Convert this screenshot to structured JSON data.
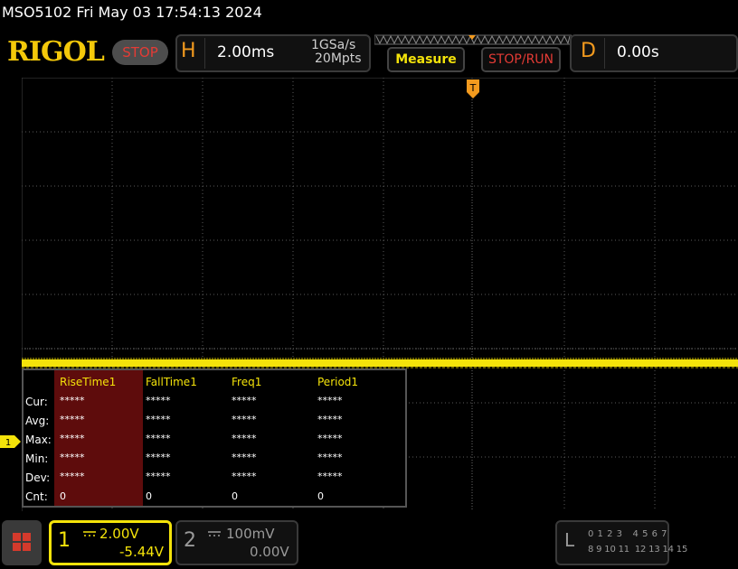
{
  "header": {
    "title": "MSO5102  Fri May 03 17:54:13 2024"
  },
  "topbar": {
    "logo": "RIGOL",
    "run_state": "STOP",
    "horizontal": {
      "letter": "H",
      "timebase": "2.00ms",
      "sample_rate": "1GSa/s",
      "memory_depth": "20Mpts"
    },
    "measure_label": "Measure",
    "stop_run_label": "STOP/RUN",
    "delay": {
      "letter": "D",
      "value": "0.00s"
    }
  },
  "measurements": {
    "headers": [
      "RiseTime1",
      "FallTime1",
      "Freq1",
      "Period1"
    ],
    "rows": [
      {
        "label": "Cur:",
        "values": [
          "*****",
          "*****",
          "*****",
          "*****"
        ]
      },
      {
        "label": "Avg:",
        "values": [
          "*****",
          "*****",
          "*****",
          "*****"
        ]
      },
      {
        "label": "Max:",
        "values": [
          "*****",
          "*****",
          "*****",
          "*****"
        ]
      },
      {
        "label": "Min:",
        "values": [
          "*****",
          "*****",
          "*****",
          "*****"
        ]
      },
      {
        "label": "Dev:",
        "values": [
          "*****",
          "*****",
          "*****",
          "*****"
        ]
      },
      {
        "label": "Cnt:",
        "values": [
          "0",
          "0",
          "0",
          "0"
        ]
      }
    ]
  },
  "markers": {
    "trigger": "T",
    "ch1": "1"
  },
  "channels": {
    "ch1": {
      "number": "1",
      "scale": "2.00V",
      "offset": "-5.44V",
      "color": "#f4e30a"
    },
    "ch2": {
      "number": "2",
      "scale": "100mV",
      "offset": "0.00V",
      "color": "#9a9a9a"
    }
  },
  "logic": {
    "letter": "L",
    "row1": "0 1 2 3   4 5 6 7",
    "row2": "8 9 10 11  12 13 14 15"
  },
  "colors": {
    "accent": "#f39a1e",
    "trace": "#f4e30a",
    "stop": "#e43b35",
    "grid": "#5a5a5a"
  }
}
